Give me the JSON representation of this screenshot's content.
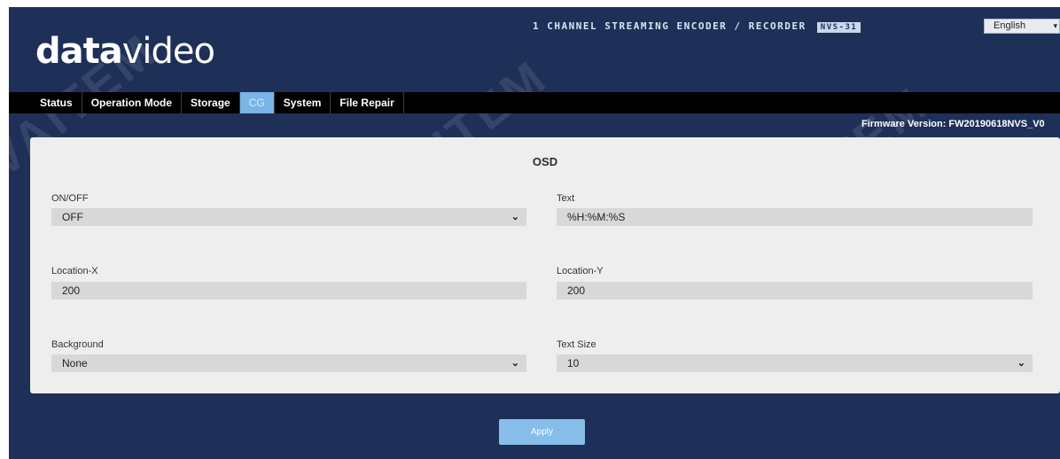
{
  "brand": {
    "logo_bold": "data",
    "logo_light": "video",
    "product_title": "1 CHANNEL STREAMING ENCODER / RECORDER",
    "model": "NVS-31"
  },
  "language": {
    "selected": "English"
  },
  "nav": {
    "tabs": [
      {
        "label": "Status",
        "active": false
      },
      {
        "label": "Operation Mode",
        "active": false
      },
      {
        "label": "Storage",
        "active": false
      },
      {
        "label": "CG",
        "active": true
      },
      {
        "label": "System",
        "active": false
      },
      {
        "label": "File Repair",
        "active": false
      }
    ]
  },
  "firmware": {
    "text": "Firmware Version: FW20190618NVS_V0"
  },
  "osd": {
    "title": "OSD",
    "on_off": {
      "label": "ON/OFF",
      "value": "OFF"
    },
    "text": {
      "label": "Text",
      "value": "%H:%M:%S"
    },
    "location_x": {
      "label": "Location-X",
      "value": "200"
    },
    "location_y": {
      "label": "Location-Y",
      "value": "200"
    },
    "background": {
      "label": "Background",
      "value": "None"
    },
    "text_size": {
      "label": "Text Size",
      "value": "10"
    }
  },
  "actions": {
    "apply_label": "Apply"
  },
  "watermark": {
    "text": "VAITEM"
  },
  "colors": {
    "page_background": "#1e3058",
    "nav_background": "#000000",
    "active_tab": "#79b5e6",
    "panel": "#eeeeee",
    "field": "#d8d8d8",
    "apply_button": "#86bde9"
  }
}
